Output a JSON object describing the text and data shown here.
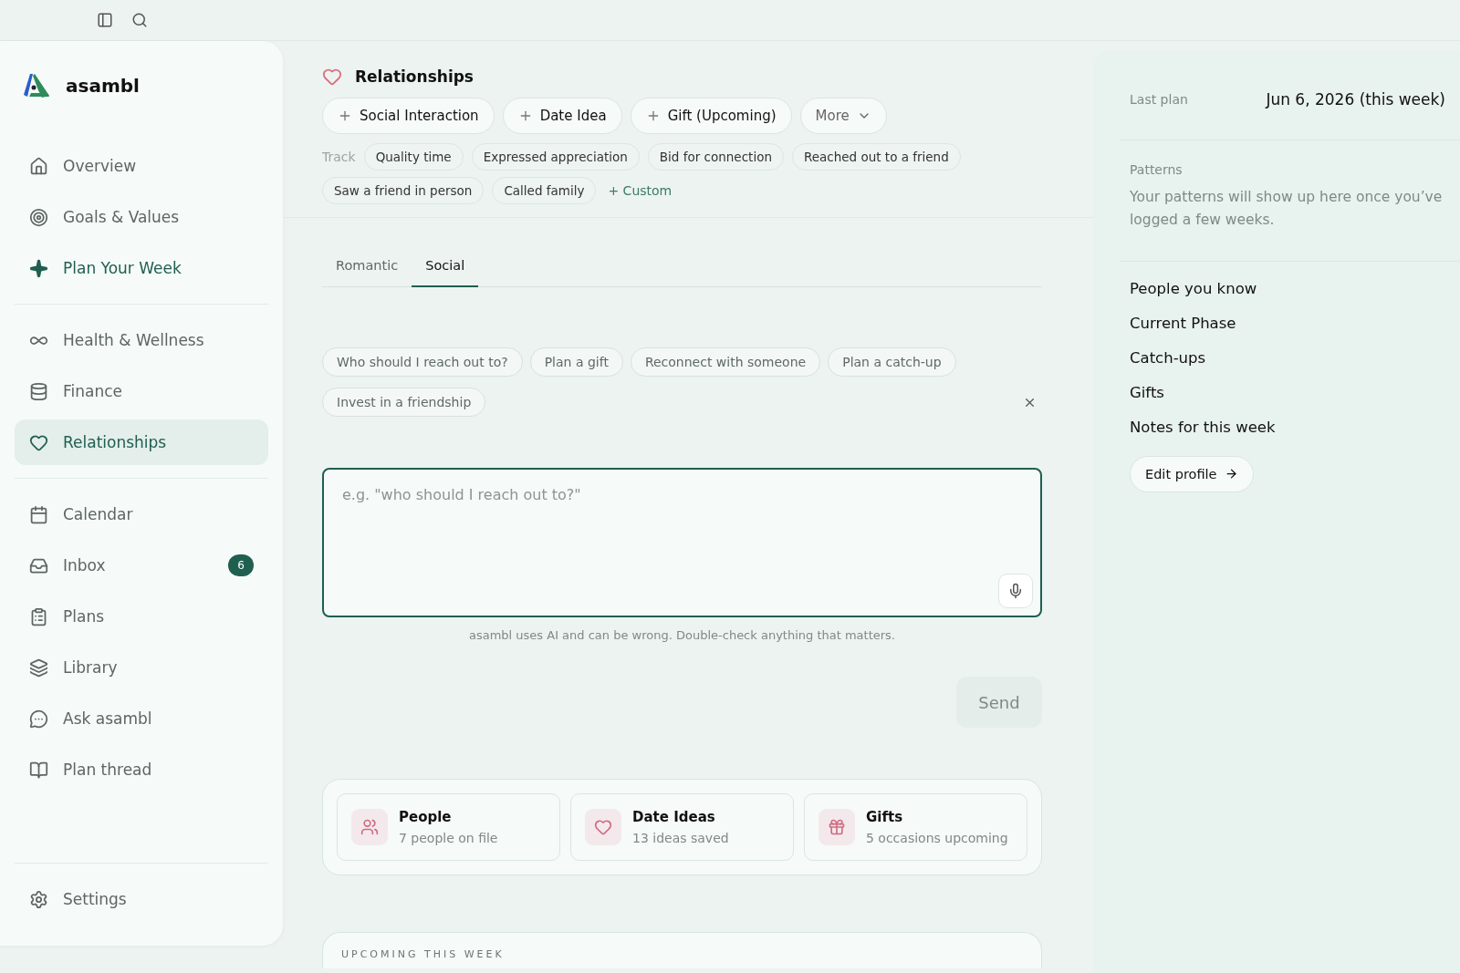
{
  "brand": {
    "name": "asambl"
  },
  "nav_groups": [
    [
      {
        "label": "Overview",
        "selected": false,
        "accent": false
      },
      {
        "label": "Goals & Values",
        "selected": false,
        "accent": false
      },
      {
        "label": "Plan Your Week",
        "selected": false,
        "accent": true
      }
    ],
    [
      {
        "label": "Health & Wellness",
        "selected": false,
        "accent": false
      },
      {
        "label": "Finance",
        "selected": false,
        "accent": false
      },
      {
        "label": "Relationships",
        "selected": true,
        "accent": false
      }
    ],
    [
      {
        "label": "Calendar",
        "selected": false,
        "accent": false
      },
      {
        "label": "Inbox",
        "selected": false,
        "accent": false,
        "badge": "6"
      },
      {
        "label": "Plans",
        "selected": false,
        "accent": false
      },
      {
        "label": "Library",
        "selected": false,
        "accent": false
      },
      {
        "label": "Ask asambl",
        "selected": false,
        "accent": false
      },
      {
        "label": "Plan thread",
        "selected": false,
        "accent": false
      }
    ]
  ],
  "settings": {
    "label": "Settings"
  },
  "page": {
    "title": "Relationships"
  },
  "add_buttons": [
    "Social Interaction",
    "Date Idea",
    "Gift (Upcoming)"
  ],
  "more_button": "More",
  "track": {
    "label": "Track",
    "chips": [
      "Quality time",
      "Expressed appreciation",
      "Bid for connection",
      "Reached out to a friend",
      "Saw a friend in person",
      "Called family"
    ],
    "custom": "+ Custom"
  },
  "tabs": [
    {
      "label": "Romantic",
      "selected": false
    },
    {
      "label": "Social",
      "selected": true
    }
  ],
  "suggestions": [
    "Who should I reach out to?",
    "Plan a gift",
    "Reconnect with someone",
    "Plan a catch-up",
    "Invest in a friendship"
  ],
  "composer": {
    "placeholder": "e.g. \"who should I reach out to?\"",
    "disclaimer": "asambl uses AI and can be wrong. Double-check anything that matters.",
    "send": "Send"
  },
  "summary_cards": [
    {
      "title": "People",
      "subtitle": "7 people on file"
    },
    {
      "title": "Date Ideas",
      "subtitle": "13 ideas saved"
    },
    {
      "title": "Gifts",
      "subtitle": "5 occasions upcoming"
    }
  ],
  "upcoming": {
    "heading": "UPCOMING THIS WEEK"
  },
  "side_panel": {
    "last_plan_label": "Last plan",
    "last_plan_value": "Jun 6, 2026 (this week)",
    "patterns_label": "Patterns",
    "patterns_text": "Your patterns will show up here once you’ve logged a few weeks.",
    "links": [
      "People you know",
      "Current Phase",
      "Catch-ups",
      "Gifts",
      "Notes for this week"
    ],
    "edit_button": "Edit profile"
  }
}
